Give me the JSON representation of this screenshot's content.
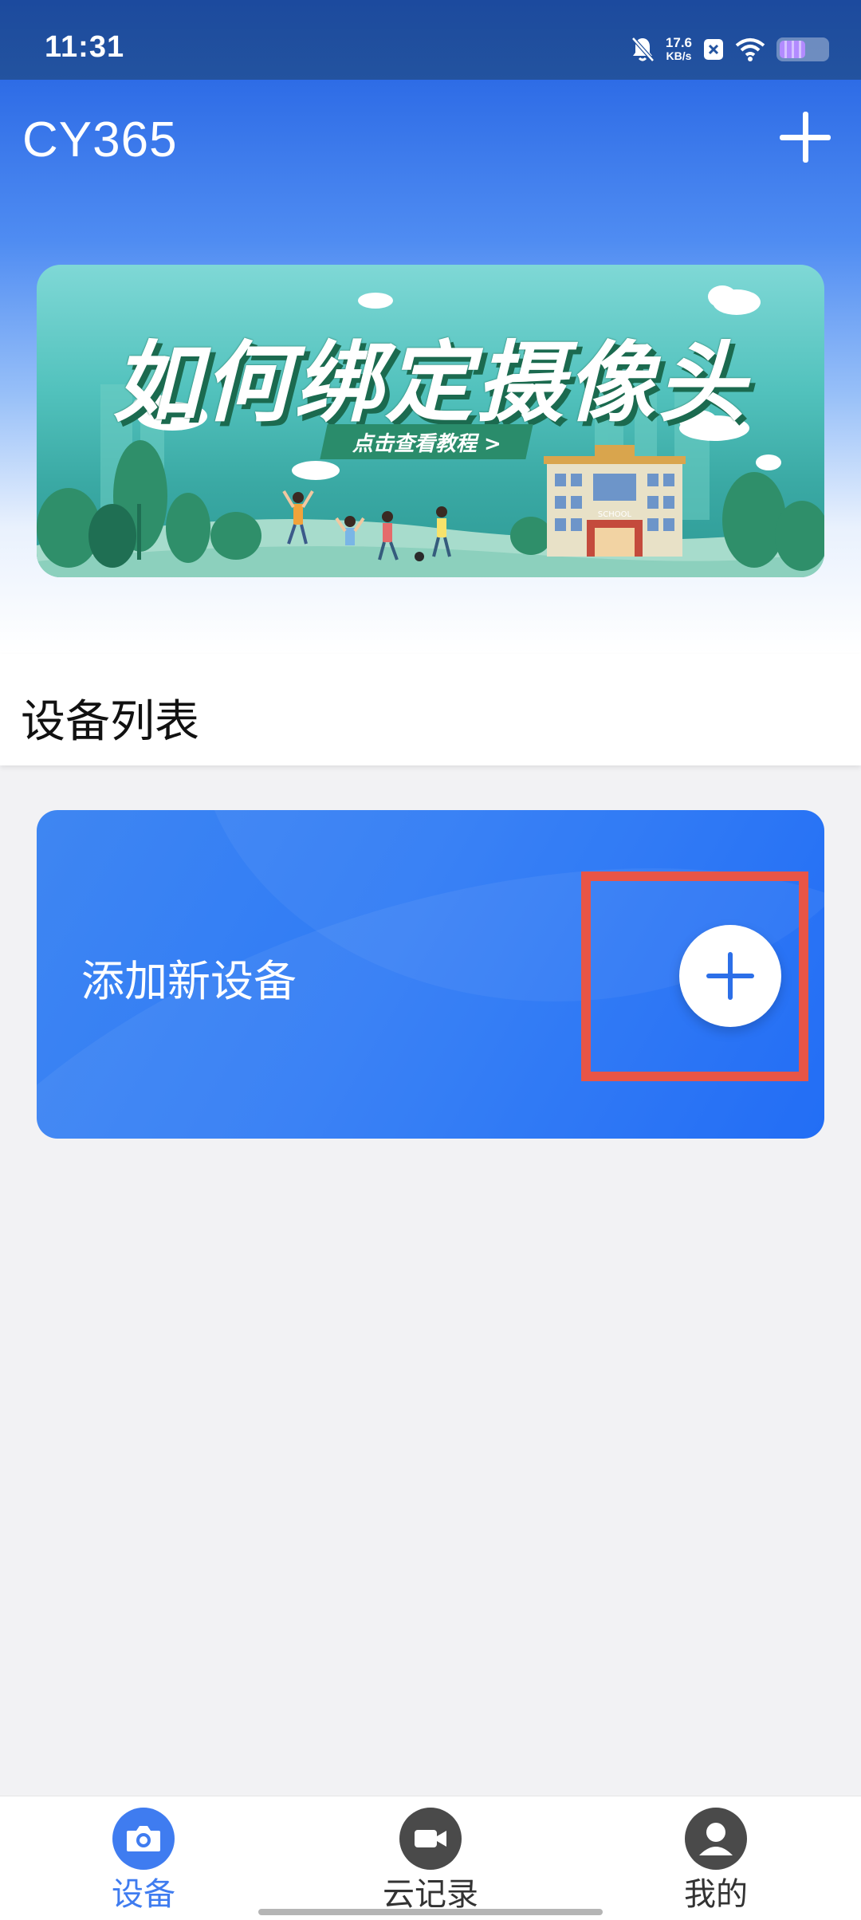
{
  "status_bar": {
    "time": "11:31",
    "net_speed_value": "17.6",
    "net_speed_unit": "KB/s",
    "battery_level": 0.55,
    "icons": [
      "bell-muted-icon",
      "notification-x-icon",
      "wifi-icon",
      "battery-icon"
    ]
  },
  "header": {
    "title": "CY365",
    "add_icon": "plus-icon"
  },
  "banner": {
    "headline": "如何绑定摄像头",
    "cta": "点击查看教程 >",
    "sign_text": "SCHOOL"
  },
  "device_list": {
    "title": "设备列表",
    "add_device_label": "添加新设备",
    "add_icon": "plus-circle-icon"
  },
  "bottom_nav": {
    "items": [
      {
        "label": "设备",
        "icon": "camera-icon",
        "active": true
      },
      {
        "label": "云记录",
        "icon": "video-camera-icon",
        "active": false
      },
      {
        "label": "我的",
        "icon": "user-icon",
        "active": false
      }
    ]
  },
  "colors": {
    "primary": "#3f7cf0",
    "card_blue": "#1565f5",
    "highlight_red": "#e85546",
    "banner_teal": "#3aa9a4"
  }
}
